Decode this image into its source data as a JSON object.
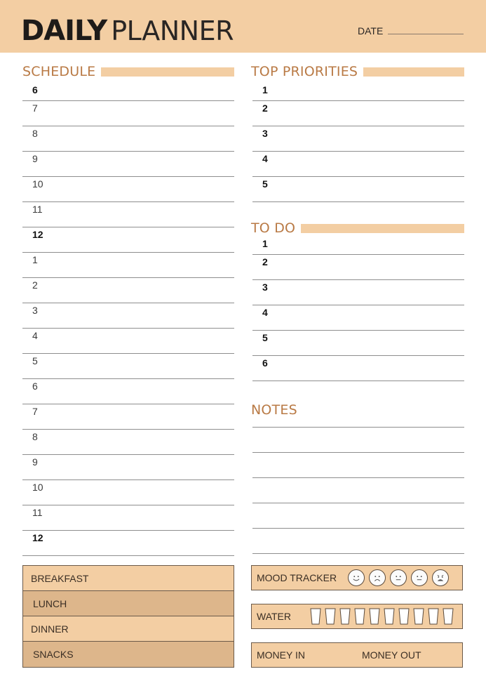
{
  "header": {
    "title_bold": "DAILY",
    "title_light": "PLANNER",
    "date_label": "DATE"
  },
  "schedule": {
    "title": "SCHEDULE",
    "hours": [
      {
        "label": "6",
        "bold": true
      },
      {
        "label": "7",
        "bold": false
      },
      {
        "label": "8",
        "bold": false
      },
      {
        "label": "9",
        "bold": false
      },
      {
        "label": "10",
        "bold": false
      },
      {
        "label": "11",
        "bold": false
      },
      {
        "label": "12",
        "bold": true
      },
      {
        "label": "1",
        "bold": false
      },
      {
        "label": "2",
        "bold": false
      },
      {
        "label": "3",
        "bold": false
      },
      {
        "label": "4",
        "bold": false
      },
      {
        "label": "5",
        "bold": false
      },
      {
        "label": "6",
        "bold": false
      },
      {
        "label": "7",
        "bold": false
      },
      {
        "label": "8",
        "bold": false
      },
      {
        "label": "9",
        "bold": false
      },
      {
        "label": "10",
        "bold": false
      },
      {
        "label": "11",
        "bold": false
      },
      {
        "label": "12",
        "bold": true
      }
    ]
  },
  "top_priorities": {
    "title": "TOP PRIORITIES",
    "items": [
      "1",
      "2",
      "3",
      "4",
      "5"
    ]
  },
  "todo": {
    "title": "TO DO",
    "items": [
      "1",
      "2",
      "3",
      "4",
      "5",
      "6"
    ]
  },
  "notes": {
    "title": "NOTES",
    "line_count": 5
  },
  "meals": [
    "BREAKFAST",
    "LUNCH",
    "DINNER",
    "SNACKS"
  ],
  "mood_tracker": {
    "label": "MOOD TRACKER",
    "faces": [
      "happy-face-icon",
      "sad-face-icon",
      "neutral-face-icon",
      "neutral-face-icon",
      "angry-face-icon"
    ]
  },
  "water": {
    "label": "WATER",
    "glass_count": 10
  },
  "money": {
    "in_label": "MONEY IN",
    "out_label": "MONEY OUT"
  },
  "colors": {
    "accent_peach": "#f3cea3",
    "accent_dark_peach": "#ddb68b",
    "heading_brown": "#b97a45"
  }
}
